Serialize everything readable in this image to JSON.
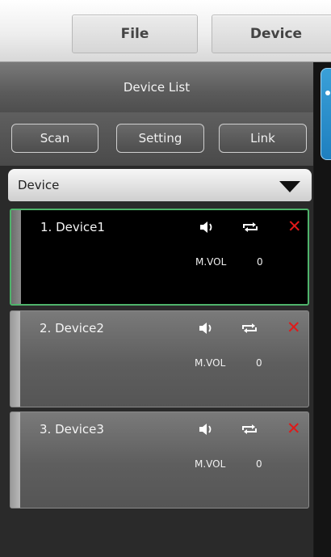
{
  "menu": {
    "file": "File",
    "device": "Device"
  },
  "panel": {
    "title": "Device List",
    "buttons": {
      "scan": "Scan",
      "setting": "Setting",
      "link": "Link"
    },
    "dropdown": {
      "selected": "Device"
    }
  },
  "devices": [
    {
      "name": "1. Device1",
      "mvol_label": "M.VOL",
      "mvol_value": "0",
      "selected": true
    },
    {
      "name": "2. Device2",
      "mvol_label": "M.VOL",
      "mvol_value": "0",
      "selected": false
    },
    {
      "name": "3. Device3",
      "mvol_label": "M.VOL",
      "mvol_value": "0",
      "selected": false
    }
  ],
  "icons": {
    "speaker": "speaker-icon",
    "loop": "loop-icon",
    "close": "close-icon"
  },
  "colors": {
    "selected_border": "#4fb36b",
    "close": "#e01919",
    "accent_tab": "#2a90cc"
  }
}
